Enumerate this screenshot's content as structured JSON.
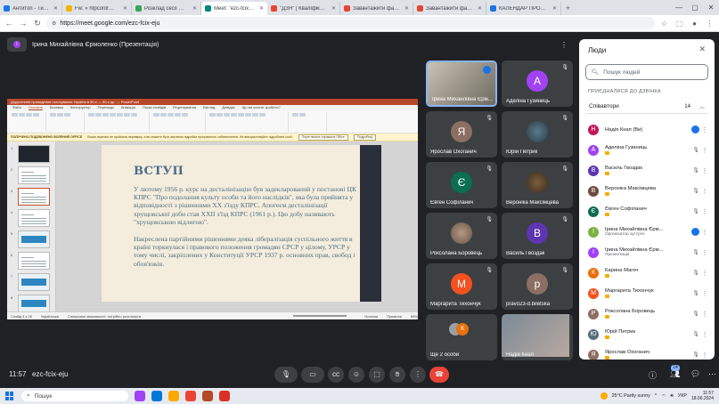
{
  "browser": {
    "tabs": [
      {
        "label": "Антитоп - Ти саме тє",
        "color": "#1a73e8",
        "active": false
      },
      {
        "label": "Fw: « hfpcontr@ukr.net",
        "color": "#f2b600",
        "active": false
      },
      {
        "label": "Розклад сесії Мукачево",
        "color": "#34a853",
        "active": false
      },
      {
        "label": "Meet: \"ezc-fcix-eju\"",
        "color": "#00897b",
        "active": true
      },
      {
        "label": "\"ДЗЯ\" | Кваліфікований в",
        "color": "#ea4335",
        "active": false
      },
      {
        "label": "Завантажити файл | Шта",
        "color": "#ea4335",
        "active": false
      },
      {
        "label": "Завантажити файл | Шта",
        "color": "#ea4335",
        "active": false
      },
      {
        "label": "КАЛЕНДАР ПРОВЕДЕНН",
        "color": "#1a73e8",
        "active": false
      }
    ],
    "new_tab": "+",
    "url": "https://meet.google.com/ezc-fcix-eju",
    "controls": {
      "minimize": "—",
      "maximize": "▢",
      "close": "✕"
    }
  },
  "presentation": {
    "presenter_label": "Ірина Михайлівна Єрмоленко (Презентація)",
    "initial": "І"
  },
  "powerpoint": {
    "title_bar": "Дорученння проведення голосування Україна в 30-х — 50-х рр. — PowerPoint",
    "menu": [
      "Файл",
      "Основне",
      "Вставка",
      "Конструктор",
      "Переходи",
      "Анімація",
      "Показ слайдів",
      "Рецензування",
      "Вигляд",
      "Довідка",
      "Що ви хочете зробити?"
    ],
    "warning_label": "ПОЛУЧЕНО ПОДЗВОНЕНО ВОЛЕНИЙ OFFICE",
    "warning_text": "Ваша ліцензія не пройшла перевірку, а ви можете бути жертвою підробки програмного забезпечення. Не використовуйте підроблені копії.",
    "warning_button1": "Перегляньте справжнє Office",
    "warning_button2": "Подробиці",
    "slide_numbers": [
      "1",
      "2",
      "3",
      "4",
      "5",
      "6",
      "7",
      "8"
    ],
    "slide_title": "ВСТУП",
    "slide_para1": "У лютому 1956 р. курс на десталінізацію був задекларований у постанові ЦК КПРС \"Про подолання культу особи та його наслідків\", яка була прийнята у відповідності з рішеннями ХХ з'їзду КПРС. Апогеєм десталінізації хрущовської доби став ХХІІ з'їзд КПРС (1961 р.). Цю добу називають \"хрущовською відлигою\".",
    "slide_para2": "Накреслена партійними рішеннями деяка лібералізація суспільного життя в країні торкнулася і правового положення громадян СРСР у цілому, УРСР у тому числі, закріплених у Конституції УРСР 1937 р. основних прав, свобод і обов'язків.",
    "status": [
      "Слайд 3 з 26",
      "Українська",
      "Спеціальні можливості: потрібно розглянути",
      "Нотатки",
      "Примітки",
      "68%"
    ]
  },
  "tiles": [
    {
      "name": "Ірина Михайлівна Єрм...",
      "initial": "",
      "color": "",
      "type": "photo"
    },
    {
      "name": "Аделіна Гузиниць",
      "initial": "А",
      "color": "#a142f4",
      "type": "avatar"
    },
    {
      "name": "Ярослав Охоганич",
      "initial": "Я",
      "color": "#8d6e63",
      "type": "avatar"
    },
    {
      "name": "Юрій Петрик",
      "initial": "",
      "color": "",
      "type": "photo"
    },
    {
      "name": "Євген Софіланич",
      "initial": "Є",
      "color": "#0b6e4f",
      "type": "avatar"
    },
    {
      "name": "Вероніка Максімцева",
      "initial": "",
      "color": "",
      "type": "photo"
    },
    {
      "name": "Роксолана Боровець",
      "initial": "",
      "color": "",
      "type": "photo"
    },
    {
      "name": "Василь Гвоздак",
      "initial": "В",
      "color": "#5e35b1",
      "type": "avatar"
    },
    {
      "name": "Маргарита Тихончук",
      "initial": "М",
      "color": "#f4511e",
      "type": "avatar"
    },
    {
      "name": "pravo23-d.biletska",
      "initial": "р",
      "color": "#8d6e63",
      "type": "avatar"
    },
    {
      "name": "Ще 2 особи",
      "initial": "К",
      "color": "#e8710a",
      "type": "more"
    },
    {
      "name": "Надія Кнап",
      "initial": "",
      "color": "",
      "type": "self"
    }
  ],
  "people_panel": {
    "title": "Люди",
    "search_placeholder": "Пошук людей",
    "section": "ПРИЄДНАЛИСЯ ДО ДЗВІНКА",
    "group": "Співавтори",
    "count": "14",
    "participants": [
      {
        "name": "Надія Кнап (Ви)",
        "role": "",
        "initial": "Н",
        "color": "#c2185b",
        "hand": false
      },
      {
        "name": "Аделіна Гузиниць",
        "role": "",
        "initial": "А",
        "color": "#a142f4",
        "hand": true
      },
      {
        "name": "Василь Гвоздак",
        "role": "",
        "initial": "В",
        "color": "#5e35b1",
        "hand": true
      },
      {
        "name": "Вероніка Максімцева",
        "role": "",
        "initial": "В",
        "color": "#6d4c41",
        "hand": true
      },
      {
        "name": "Євген Софіланич",
        "role": "",
        "initial": "Є",
        "color": "#0b6e4f",
        "hand": true
      },
      {
        "name": "Ірина Михайлівна Єрм...",
        "role": "Організатор зустрічі",
        "initial": "І",
        "color": "#7cb342",
        "hand": false
      },
      {
        "name": "Ірина Михайлівна Єрм...",
        "role": "Презентація",
        "initial": "І",
        "color": "#a142f4",
        "hand": false
      },
      {
        "name": "Карина Магоч",
        "role": "",
        "initial": "К",
        "color": "#e8710a",
        "hand": true
      },
      {
        "name": "Маргарита Тихончук",
        "role": "",
        "initial": "М",
        "color": "#f4511e",
        "hand": true
      },
      {
        "name": "Роксолана Боровець",
        "role": "",
        "initial": "Р",
        "color": "#8d6e63",
        "hand": true
      },
      {
        "name": "Юрій Петрик",
        "role": "",
        "initial": "Ю",
        "color": "#546e7a",
        "hand": true
      },
      {
        "name": "Ярослав Охоганич",
        "role": "",
        "initial": "Я",
        "color": "#8d6e63",
        "hand": true
      }
    ]
  },
  "controls": {
    "time": "11:57",
    "meeting_code": "ezc-fcix-eju",
    "people_count": "14"
  },
  "taskbar": {
    "search": "Пошук",
    "weather": "25°C  Partly sunny",
    "lang": "УКР",
    "time": "11:57",
    "date": "18.06.2024"
  },
  "colors": {
    "accent": "#8ab4f8",
    "end_call": "#ea4335",
    "meet_bg": "#202124"
  }
}
